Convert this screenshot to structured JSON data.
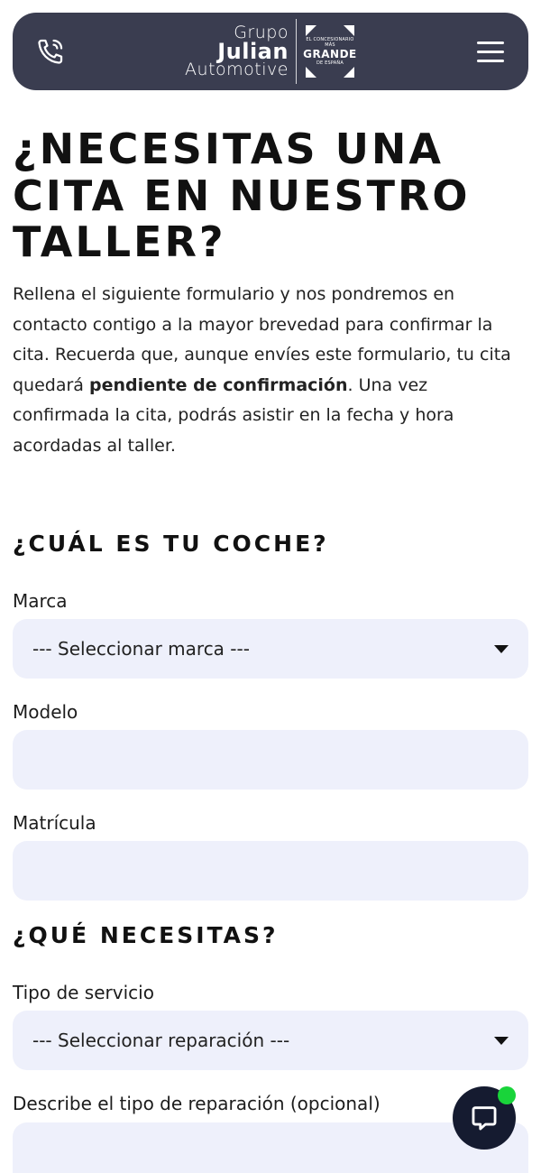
{
  "header": {
    "logo": {
      "line1": "Grupo",
      "line2": "Julian",
      "line3": "Automotive"
    },
    "badge": {
      "top": "EL CONCESIONARIO MÁS",
      "main": "GRANDE",
      "bottom": "DE ESPAÑA"
    },
    "phone_icon": "phone-icon",
    "menu_icon": "hamburger-icon"
  },
  "page": {
    "title": "¿Necesitas una cita en nuestro taller?",
    "intro_part1": "Rellena el siguiente formulario y nos pondremos en contacto contigo a la mayor brevedad para confirmar la cita. Recuerda que, aunque envíes este formulario, tu cita quedará ",
    "intro_bold": "pendiente de confirmación",
    "intro_part2": ". Una vez confirmada la cita, podrás asistir en la fecha y hora acordadas al taller."
  },
  "section_car": {
    "heading": "¿Cuál es tu coche?",
    "marca_label": "Marca",
    "marca_value": "--- Seleccionar marca ---",
    "modelo_label": "Modelo",
    "modelo_value": "",
    "matricula_label": "Matrícula",
    "matricula_value": ""
  },
  "section_need": {
    "heading": "¿Qué necesitas?",
    "servicio_label": "Tipo de servicio",
    "servicio_value": "--- Seleccionar reparación ---",
    "describe_label": "Describe el tipo de reparación (opcional)",
    "describe_value": ""
  },
  "chat": {
    "icon": "chat-bubble-icon",
    "status_color": "#19d43a"
  },
  "colors": {
    "header_bg": "#3a3d50",
    "field_bg": "#eef0fb",
    "chat_bg": "#151b30"
  }
}
